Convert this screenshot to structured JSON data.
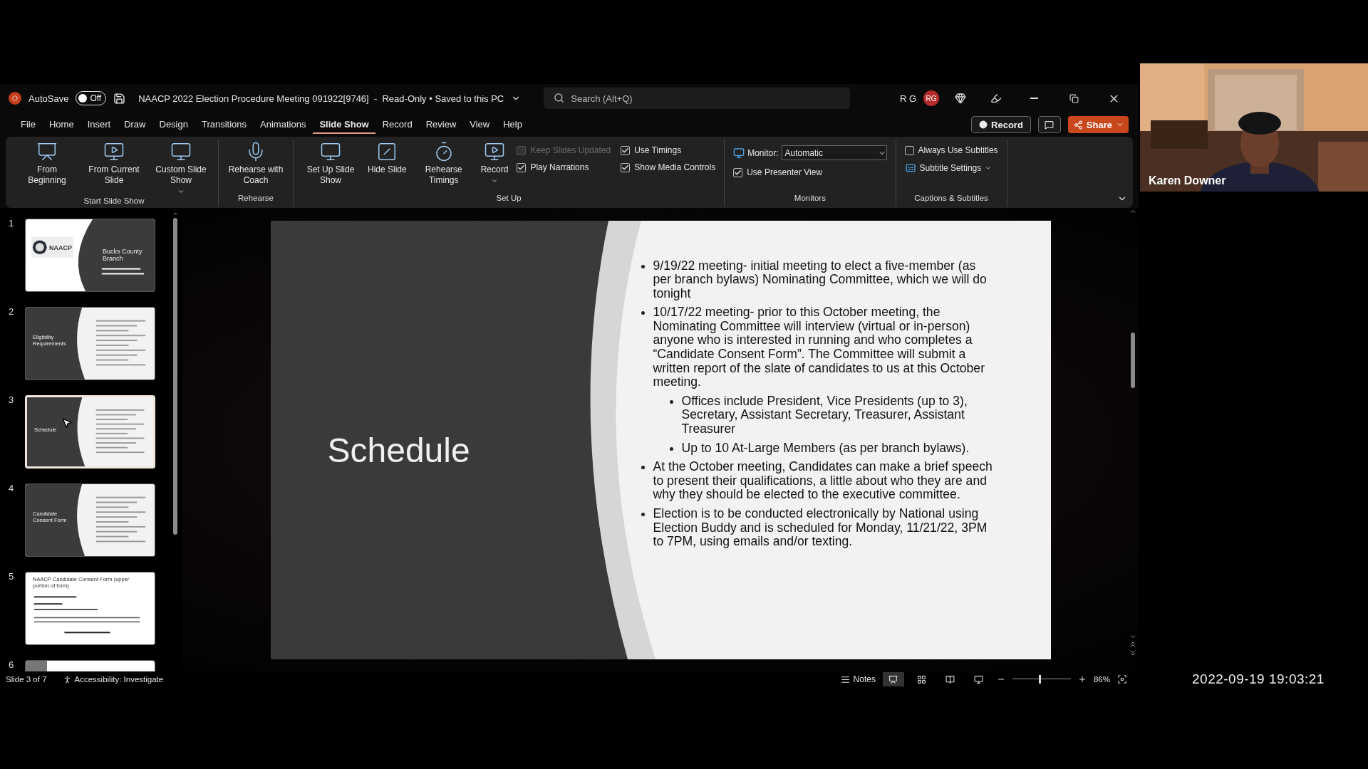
{
  "title_bar": {
    "autosave_label": "AutoSave",
    "autosave": {
      "on": false,
      "label": "Off"
    },
    "document_title": "NAACP 2022 Election Procedure Meeting 091922[9746]  -  Read-Only • Saved to this PC",
    "search": {
      "placeholder": "Search (Alt+Q)"
    },
    "user_initials": "R G",
    "avatar": "RG"
  },
  "menu_tabs": [
    {
      "label": "File",
      "selected": false
    },
    {
      "label": "Home",
      "selected": false
    },
    {
      "label": "Insert",
      "selected": false
    },
    {
      "label": "Draw",
      "selected": false
    },
    {
      "label": "Design",
      "selected": false
    },
    {
      "label": "Transitions",
      "selected": false
    },
    {
      "label": "Animations",
      "selected": false
    },
    {
      "label": "Slide Show",
      "selected": true
    },
    {
      "label": "Record",
      "selected": false
    },
    {
      "label": "Review",
      "selected": false
    },
    {
      "label": "View",
      "selected": false
    },
    {
      "label": "Help",
      "selected": false
    }
  ],
  "header_buttons": {
    "record": "Record",
    "share": "Share"
  },
  "ribbon": [
    {
      "label": "Start Slide Show",
      "items": [
        {
          "kind": "large",
          "label": "From Beginning",
          "dropdown": false
        },
        {
          "kind": "large",
          "label": "From Current Slide",
          "dropdown": false
        },
        {
          "kind": "large",
          "label": "Custom Slide Show",
          "dropdown": true
        }
      ]
    },
    {
      "label": "Rehearse",
      "items": [
        {
          "kind": "large",
          "label": "Rehearse with Coach",
          "dropdown": false
        }
      ]
    },
    {
      "label": "Set Up",
      "items": [
        {
          "kind": "large",
          "label": "Set Up Slide Show",
          "dropdown": false
        },
        {
          "kind": "large",
          "label": "Hide Slide",
          "dropdown": false
        },
        {
          "kind": "large",
          "label": "Rehearse Timings",
          "dropdown": false
        },
        {
          "kind": "large",
          "label": "Record",
          "dropdown": true
        },
        {
          "kind": "stack",
          "items": [
            {
              "kind": "checkbox",
              "label": "Keep Slides Updated",
              "checked": false,
              "disabled": true
            },
            {
              "kind": "checkbox",
              "label": "Play Narrations",
              "checked": true,
              "disabled": false
            }
          ]
        },
        {
          "kind": "stack",
          "items": [
            {
              "kind": "checkbox",
              "label": "Use Timings",
              "checked": true,
              "disabled": false
            },
            {
              "kind": "checkbox",
              "label": "Show Media Controls",
              "checked": true,
              "disabled": false
            }
          ]
        }
      ]
    },
    {
      "label": "Monitors",
      "items": [
        {
          "kind": "stack",
          "items": [
            {
              "kind": "dropdown",
              "label": "Monitor:",
              "value": "Automatic"
            },
            {
              "kind": "checkbox",
              "label": "Use Presenter View",
              "checked": true,
              "disabled": false
            }
          ]
        }
      ]
    },
    {
      "label": "Captions & Subtitles",
      "items": [
        {
          "kind": "stack",
          "items": [
            {
              "kind": "checkbox",
              "label": "Always Use Subtitles",
              "checked": false,
              "disabled": false
            },
            {
              "kind": "menu",
              "label": "Subtitle Settings"
            }
          ]
        }
      ]
    }
  ],
  "slides": [
    {
      "number": "1",
      "kind": "title",
      "selected": false,
      "logo": "NAACP",
      "title": "Bucks County Branch"
    },
    {
      "number": "2",
      "kind": "section",
      "selected": false,
      "title": "Eligibility Requirements"
    },
    {
      "number": "3",
      "kind": "section",
      "selected": true,
      "title": "Schedule"
    },
    {
      "number": "4",
      "kind": "section",
      "selected": false,
      "title": "Candidate Consent Form"
    },
    {
      "number": "5",
      "kind": "form",
      "selected": false,
      "title": "NAACP Candidate Consent Form (upper portion of form)"
    },
    {
      "number": "6",
      "kind": "cut",
      "selected": false
    }
  ],
  "current_slide": {
    "title": "Schedule",
    "bullets": [
      {
        "text": "9/19/22 meeting- initial meeting to elect a five-member (as per branch bylaws) Nominating Committee, which we will do tonight"
      },
      {
        "text": "10/17/22 meeting- prior to this October meeting, the Nominating Committee will interview (virtual or in-person) anyone who is interested in running and who completes a “Candidate Consent Form”. The Committee will submit a written report of the slate of candidates to us at this October meeting.",
        "children": [
          {
            "text": "Offices include President, Vice Presidents (up to 3), Secretary, Assistant Secretary, Treasurer, Assistant Treasurer"
          },
          {
            "text": "Up to 10 At-Large Members (as per branch bylaws)."
          }
        ]
      },
      {
        "text": "At the October meeting, Candidates can make a brief speech to present their qualifications, a little about who they are and why they should be elected to the executive committee."
      },
      {
        "text": "Election is to be conducted electronically by National using Election Buddy and is scheduled for Monday, 11/21/22, 3PM to 7PM, using emails and/or texting."
      }
    ]
  },
  "status_bar": {
    "slide_position": "Slide 3 of 7",
    "accessibility": "Accessibility: Investigate",
    "notes": "Notes",
    "views": [
      {
        "selected": true
      },
      {
        "selected": false
      },
      {
        "selected": false
      },
      {
        "selected": false
      }
    ],
    "zoom": {
      "level": 0.45,
      "label": "86%"
    }
  },
  "video": {
    "participant_name": "Karen Downer"
  },
  "timestamp": "2022-09-19 19:03:21"
}
